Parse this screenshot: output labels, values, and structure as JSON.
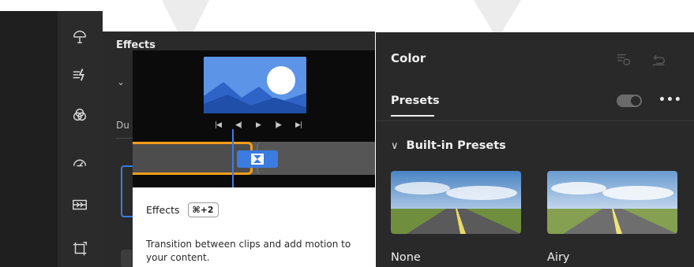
{
  "sidebar": {
    "icons": [
      "adjust-tool-icon",
      "effects-icon",
      "color-icon",
      "speed-icon",
      "transitions-icon",
      "crop-icon"
    ]
  },
  "effects_panel": {
    "title": "Effects",
    "duration_label": "Du"
  },
  "tooltip": {
    "title": "Effects",
    "shortcut": "⌘+2",
    "description": "Transition between clips and add motion to your content."
  },
  "color_panel": {
    "title": "Color",
    "tab_label": "Presets",
    "more_label": "•••",
    "section_label": "Built-in Presets",
    "presets": [
      "None",
      "Airy"
    ]
  },
  "colors": {
    "accent_orange": "#f49c1a",
    "accent_blue": "#3c7be0"
  }
}
